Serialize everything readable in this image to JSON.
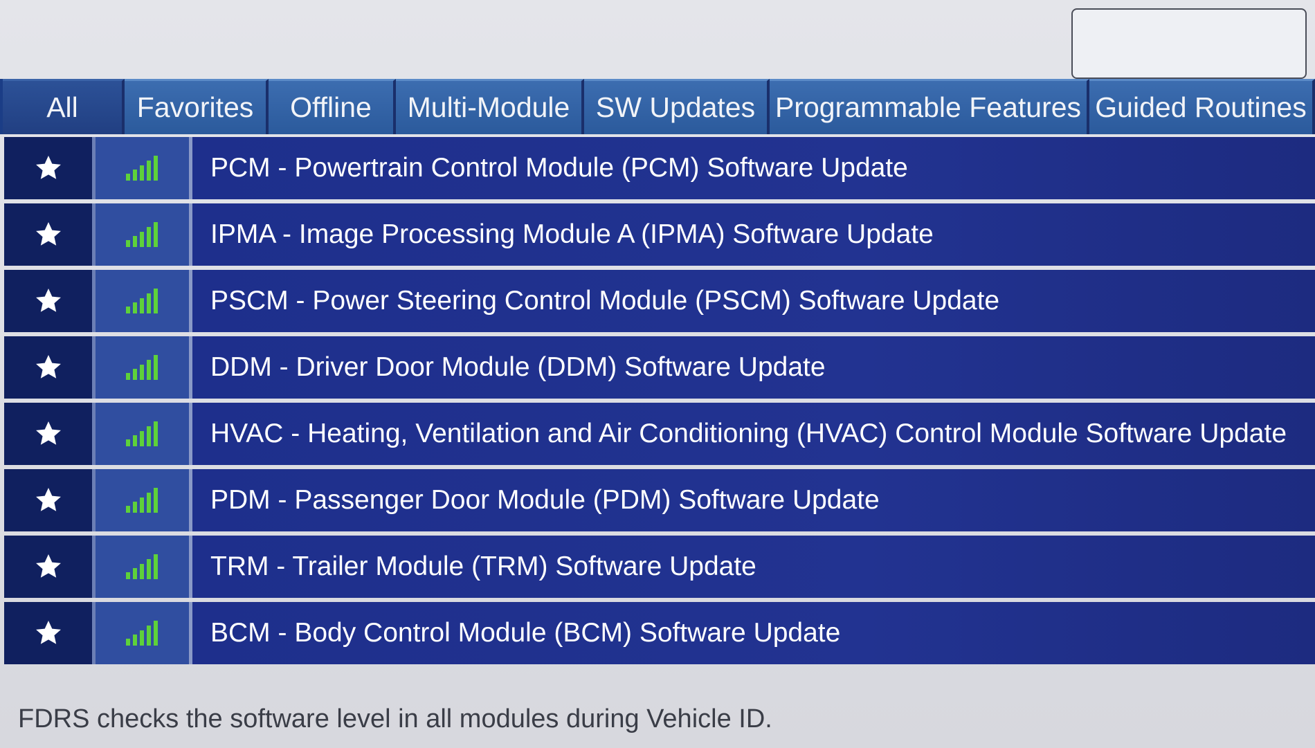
{
  "tabs": [
    {
      "label": "All",
      "width": 176,
      "active": true
    },
    {
      "label": "Favorites",
      "width": 208,
      "active": false
    },
    {
      "label": "Offline",
      "width": 184,
      "active": false
    },
    {
      "label": "Multi-Module",
      "width": 272,
      "active": false
    },
    {
      "label": "SW Updates",
      "width": 268,
      "active": false
    },
    {
      "label": "Programmable Features",
      "width": 462,
      "active": false
    },
    {
      "label": "Guided Routines",
      "width": 326,
      "active": false
    }
  ],
  "rows": [
    {
      "label": "PCM - Powertrain Control Module (PCM) Software Update"
    },
    {
      "label": "IPMA - Image Processing Module A (IPMA) Software Update"
    },
    {
      "label": "PSCM - Power Steering Control Module (PSCM) Software Update"
    },
    {
      "label": "DDM - Driver Door Module (DDM) Software Update"
    },
    {
      "label": "HVAC - Heating, Ventilation and Air Conditioning (HVAC) Control Module Software Update"
    },
    {
      "label": "PDM - Passenger Door Module (PDM) Software Update"
    },
    {
      "label": "TRM - Trailer Module (TRM) Software Update"
    },
    {
      "label": "BCM - Body Control Module (BCM) Software Update"
    }
  ],
  "footer": {
    "note": "FDRS checks the software level in all modules during Vehicle ID."
  },
  "colors": {
    "signal_green": "#5ed13a",
    "star_white": "#ffffff"
  },
  "icons": {
    "favorite": "star-icon",
    "connectivity": "signal-bars-icon"
  }
}
